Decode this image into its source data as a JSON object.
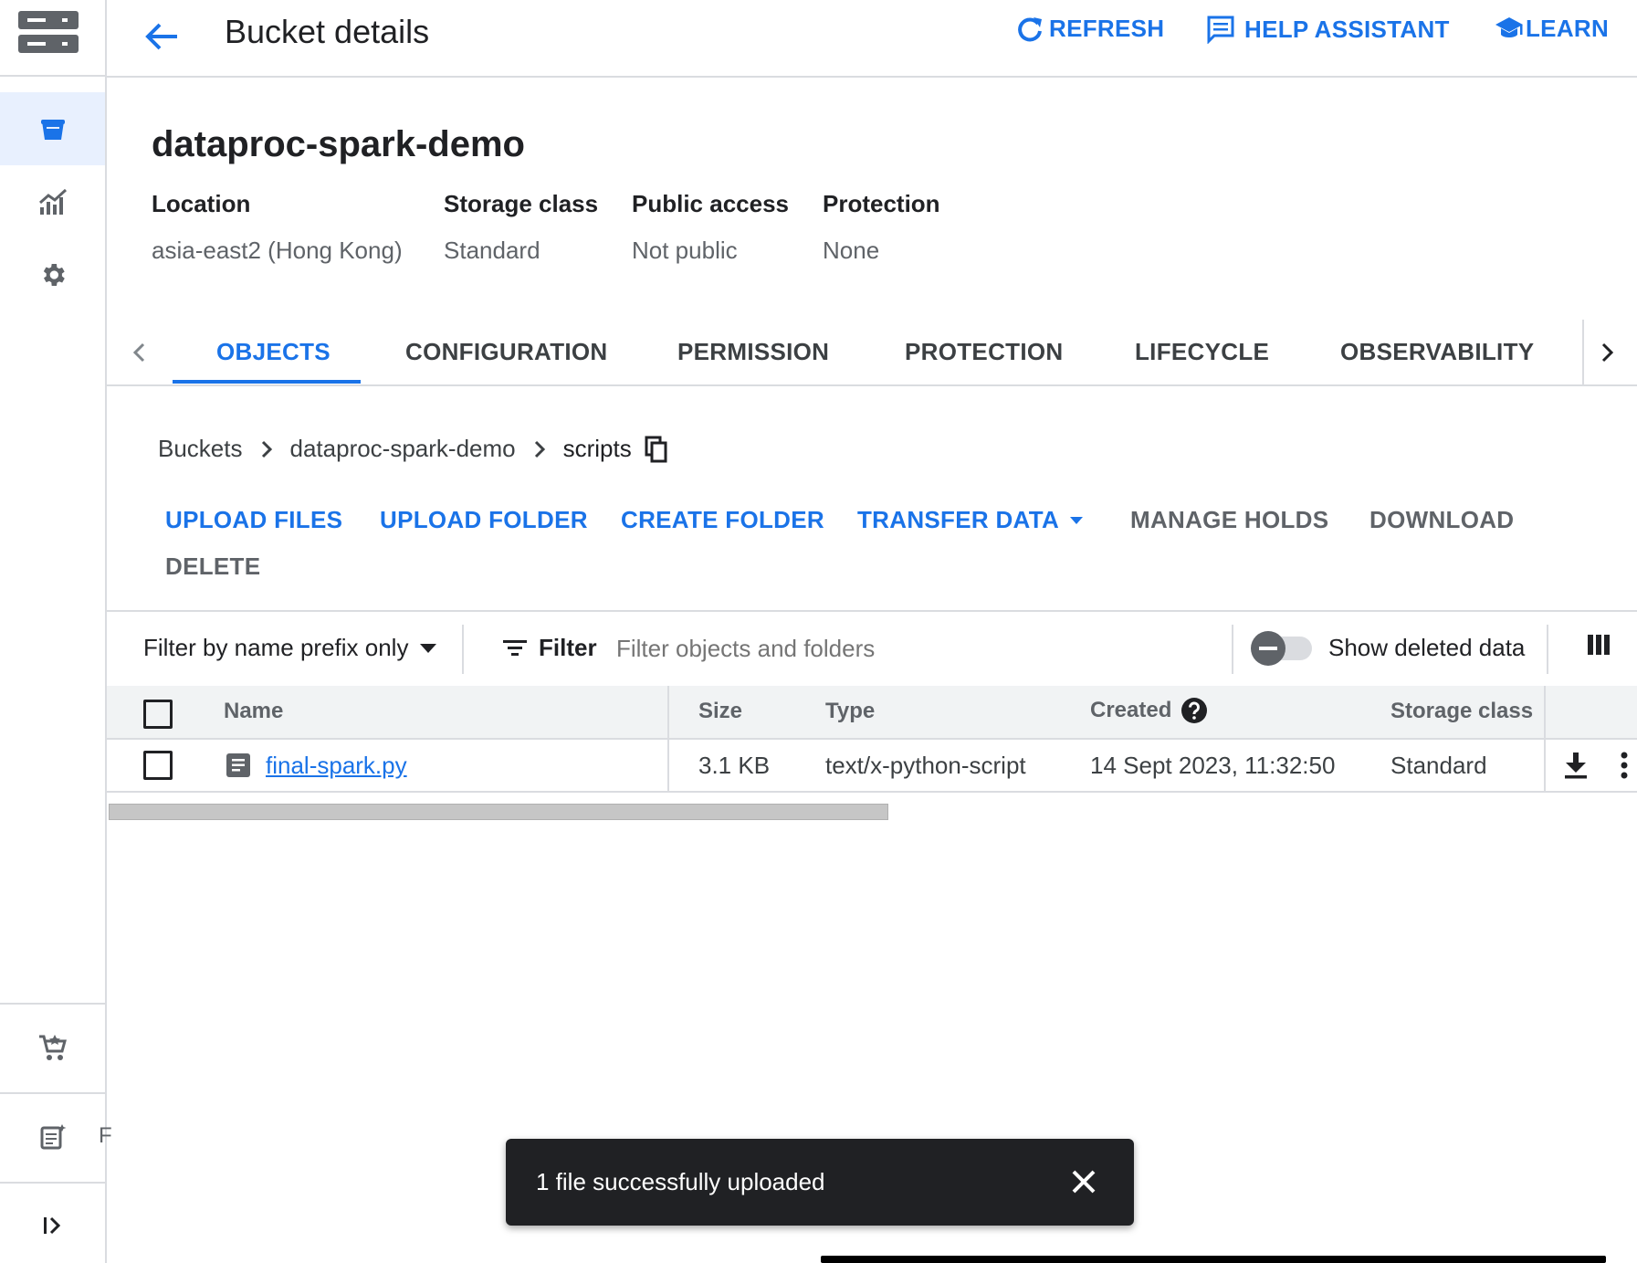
{
  "header": {
    "title": "Bucket details",
    "actions": {
      "refresh": "REFRESH",
      "help_assistant": "HELP ASSISTANT",
      "learn": "LEARN"
    }
  },
  "bucket": {
    "name": "dataproc-spark-demo",
    "meta": [
      {
        "label": "Location",
        "value": "asia-east2 (Hong Kong)"
      },
      {
        "label": "Storage class",
        "value": "Standard"
      },
      {
        "label": "Public access",
        "value": "Not public"
      },
      {
        "label": "Protection",
        "value": "None"
      }
    ]
  },
  "tabs": [
    "OBJECTS",
    "CONFIGURATION",
    "PERMISSION",
    "PROTECTION",
    "LIFECYCLE",
    "OBSERVABILITY"
  ],
  "active_tab": "OBJECTS",
  "breadcrumb": {
    "items": [
      "Buckets",
      "dataproc-spark-demo"
    ],
    "current": "scripts"
  },
  "object_actions": {
    "upload_files": "UPLOAD FILES",
    "upload_folder": "UPLOAD FOLDER",
    "create_folder": "CREATE FOLDER",
    "transfer_data": "TRANSFER DATA",
    "manage_holds": "MANAGE HOLDS",
    "download": "DOWNLOAD",
    "delete": "DELETE"
  },
  "filter": {
    "mode": "Filter by name prefix only",
    "label": "Filter",
    "placeholder": "Filter objects and folders",
    "show_deleted_label": "Show deleted data"
  },
  "table": {
    "columns": {
      "name": "Name",
      "size": "Size",
      "type": "Type",
      "created": "Created",
      "storage_class": "Storage class"
    },
    "rows": [
      {
        "name": "final-spark.py",
        "size": "3.1 KB",
        "type": "text/x-python-script",
        "created": "14 Sept 2023, 11:32:50",
        "storage_class": "Standard"
      }
    ]
  },
  "sidebar": {
    "partial_label": "F"
  },
  "snackbar": {
    "message": "1 file successfully uploaded"
  },
  "colors": {
    "accent": "#1a73e8",
    "text": "#202124",
    "muted": "#5f6368",
    "divider": "#dadce0",
    "snackbar_bg": "#202124"
  },
  "icons": {
    "rail": [
      "storage-logo-icon",
      "bucket-icon",
      "monitoring-icon",
      "settings-icon",
      "marketplace-icon",
      "release-notes-icon",
      "expand-sidebar-icon"
    ],
    "header": [
      "back-arrow-icon",
      "refresh-icon",
      "help-assistant-icon",
      "learn-icon"
    ]
  }
}
